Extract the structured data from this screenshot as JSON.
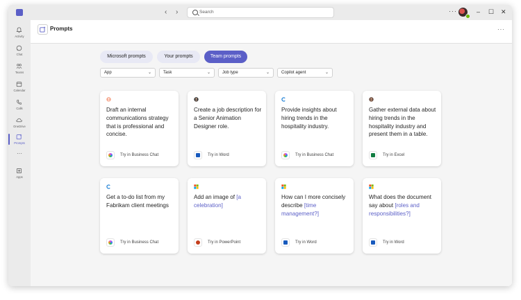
{
  "titlebar": {
    "search_placeholder": "Search",
    "more_label": "···",
    "minimize": "–",
    "maximize": "☐",
    "close": "✕"
  },
  "rail": {
    "items": [
      {
        "label": "Activity",
        "icon": "bell-icon"
      },
      {
        "label": "Chat",
        "icon": "chat-icon"
      },
      {
        "label": "Teams",
        "icon": "teams-icon"
      },
      {
        "label": "Calendar",
        "icon": "calendar-icon"
      },
      {
        "label": "Calls",
        "icon": "phone-icon"
      },
      {
        "label": "OneDrive",
        "icon": "cloud-icon"
      },
      {
        "label": "Prompts",
        "icon": "prompts-icon",
        "active": true
      }
    ],
    "more_label": "···",
    "apps_label": "Apps"
  },
  "header": {
    "title": "Prompts",
    "more_label": "···"
  },
  "tabs": [
    {
      "label": "Microsoft prompts",
      "active": false
    },
    {
      "label": "Your prompts",
      "active": false
    },
    {
      "label": "Team prompts",
      "active": true
    }
  ],
  "filters": [
    {
      "label": "App"
    },
    {
      "label": "Task"
    },
    {
      "label": "Job type"
    },
    {
      "label": "Copilot agent"
    }
  ],
  "cards": [
    {
      "avatar": "person-avatar-icon",
      "text": "Draft an internal communications strategy that is professional and concise.",
      "action": "Try in Business Chat",
      "app_icon": "copilot-icon"
    },
    {
      "avatar": "person-avatar-icon",
      "text": "Create a job description for a Senior Animation Designer role.",
      "action": "Try in Word",
      "app_icon": "word-icon"
    },
    {
      "avatar": "copilot-logo-icon",
      "text": "Provide insights about hiring trends in the hospitality industry.",
      "action": "Try in Business Chat",
      "app_icon": "copilot-icon"
    },
    {
      "avatar": "person-avatar-icon",
      "text": "Gather external data about hiring trends in the hospitality industry and present them in a table.",
      "action": "Try in Excel",
      "app_icon": "excel-icon"
    },
    {
      "avatar": "copilot-logo-icon",
      "text": "Get a to-do list from my Fabrikam client meetings",
      "action": "Try in Business Chat",
      "app_icon": "copilot-icon"
    },
    {
      "avatar": "microsoft-logo-icon",
      "text_before": "Add an image of ",
      "placeholder": "[a celebration]",
      "text_after": "",
      "action": "Try in PowerPoint",
      "app_icon": "powerpoint-icon"
    },
    {
      "avatar": "microsoft-logo-icon",
      "text_before": "How can I more concisely describe ",
      "placeholder": "[time management?]",
      "text_after": "",
      "action": "Try in Word",
      "app_icon": "word-icon"
    },
    {
      "avatar": "microsoft-logo-icon",
      "text_before": "What does the document say about ",
      "placeholder": "[roles and responsibilities?]",
      "text_after": "",
      "action": "Try in Word",
      "app_icon": "word-icon"
    }
  ],
  "colors": {
    "accent": "#5b5fc7",
    "word": "#185abd",
    "excel": "#107c41",
    "powerpoint": "#c43e1c"
  }
}
